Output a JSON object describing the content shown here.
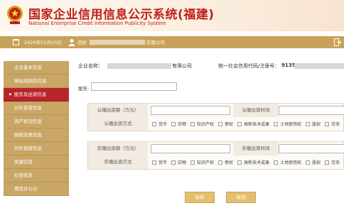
{
  "header": {
    "title_zh": "国家企业信用信息公示系统(福建)",
    "title_en": "National Enterprise Credit Information Publicity System"
  },
  "infobar": {
    "date": "2020年01月03日",
    "welcome": "您好",
    "welcome_suffix": "有限公司"
  },
  "sidebar": {
    "items": [
      {
        "label": "企业基本信息"
      },
      {
        "label": "网站或网店信息"
      },
      {
        "label": "股东及出资信息",
        "active": true
      },
      {
        "label": "对外投资信息"
      },
      {
        "label": "资产状况信息"
      },
      {
        "label": "股权变更信息"
      },
      {
        "label": "对外担保信息"
      },
      {
        "label": "党建信息"
      },
      {
        "label": "社保信息"
      },
      {
        "label": "预览并公示"
      }
    ]
  },
  "main": {
    "company_label": "企业名称：",
    "company_suffix": "有限公司",
    "credit_label": "统一社会信用代码/注册号：",
    "credit_prefix": "9135",
    "holder_label": "股东:",
    "subscribed": {
      "amount_label": "认缴出资额（万元）",
      "time_label": "认缴出资时间",
      "method_label": "认缴出资方式"
    },
    "paid": {
      "amount_label": "实缴出资额（万元）",
      "time_label": "实缴出资时间",
      "method_label": "实缴出资方式"
    },
    "options": [
      "货币",
      "实物",
      "知识产权",
      "债权",
      "高新技术成果",
      "土地使用权",
      "股权",
      "劳务",
      "其"
    ],
    "save_label": "保存",
    "cancel_label": "取消"
  }
}
